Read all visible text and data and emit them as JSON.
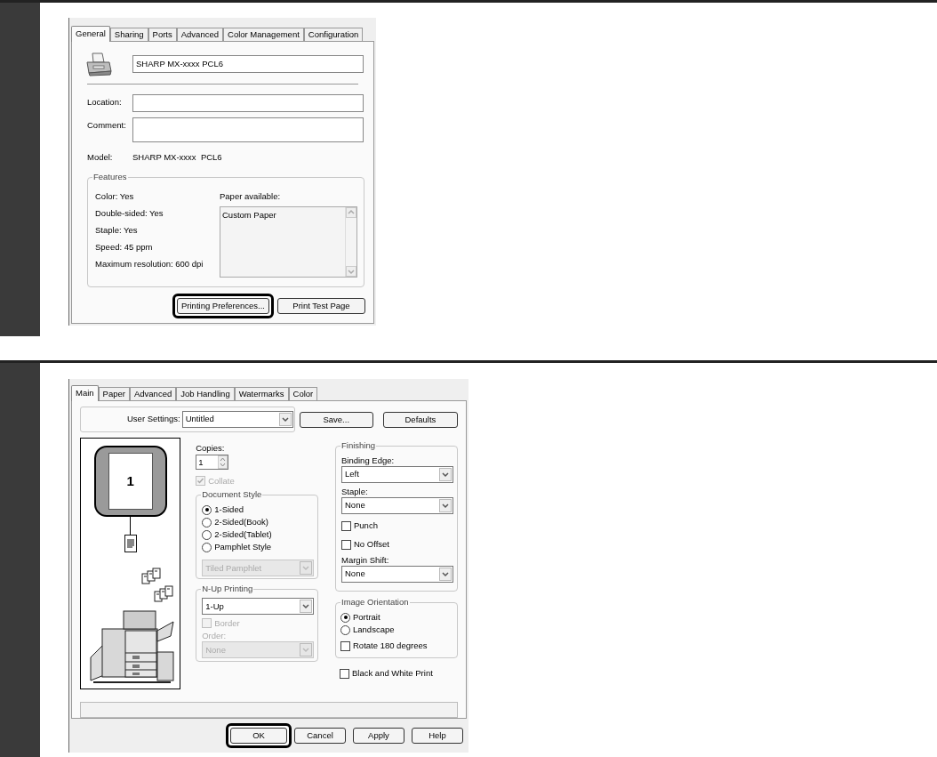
{
  "printer_properties": {
    "tabs": [
      {
        "label": "General",
        "selected": true
      },
      {
        "label": "Sharing",
        "selected": false
      },
      {
        "label": "Ports",
        "selected": false
      },
      {
        "label": "Advanced",
        "selected": false
      },
      {
        "label": "Color Management",
        "selected": false
      },
      {
        "label": "Configuration",
        "selected": false
      }
    ],
    "printer_name": "SHARP MX-xxxx PCL6",
    "fields": [
      {
        "label": "Location:",
        "kind": "line"
      },
      {
        "label": "Comment:",
        "kind": "box"
      }
    ],
    "model": {
      "label": "Model:",
      "value": "SHARP MX-xxxx  PCL6"
    },
    "features": {
      "title": "Features",
      "items": [
        "Color: Yes",
        "Double-sided: Yes",
        "Staple: Yes",
        "Speed: 45 ppm",
        "Maximum resolution: 600 dpi"
      ],
      "paper_label": "Paper available:",
      "paper_list": [
        "Custom Paper"
      ]
    },
    "buttons": [
      {
        "label": "Printing Preferences...",
        "highlighted": true
      },
      {
        "label": "Print Test Page",
        "highlighted": false
      }
    ]
  },
  "printing_preferences": {
    "tabs": [
      {
        "label": "Main",
        "selected": true
      },
      {
        "label": "Paper",
        "selected": false
      },
      {
        "label": "Advanced",
        "selected": false
      },
      {
        "label": "Job Handling",
        "selected": false
      },
      {
        "label": "Watermarks",
        "selected": false
      },
      {
        "label": "Color",
        "selected": false
      }
    ],
    "user_settings": {
      "label": "User Settings:",
      "value": "Untitled"
    },
    "top_buttons": [
      {
        "label": "Save..."
      },
      {
        "label": "Defaults"
      }
    ],
    "preview": {
      "page_number": "1"
    },
    "copies": {
      "label": "Copies:",
      "value": "1"
    },
    "collate": {
      "label": "Collate",
      "checked": true,
      "disabled": true
    },
    "document_style": {
      "title": "Document Style",
      "options": [
        {
          "label": "1-Sided",
          "selected": true
        },
        {
          "label": "2-Sided(Book)",
          "selected": false
        },
        {
          "label": "2-Sided(Tablet)",
          "selected": false
        },
        {
          "label": "Pamphlet Style",
          "selected": false
        }
      ],
      "pamphlet": {
        "value": "Tiled Pamphlet",
        "disabled": true
      }
    },
    "n_up": {
      "title": "N-Up Printing",
      "value": "1-Up",
      "border": {
        "label": "Border",
        "checked": false,
        "disabled": true
      },
      "order_label": "Order:",
      "order": {
        "value": "None",
        "disabled": true
      }
    },
    "finishing": {
      "title": "Finishing",
      "binding_edge_label": "Binding Edge:",
      "binding_edge": "Left",
      "staple_label": "Staple:",
      "staple": "None",
      "checks": [
        {
          "label": "Punch",
          "checked": false
        },
        {
          "label": "No Offset",
          "checked": false
        }
      ],
      "margin_shift_label": "Margin Shift:",
      "margin_shift": "None"
    },
    "image_orientation": {
      "title": "Image Orientation",
      "options": [
        {
          "label": "Portrait",
          "selected": true
        },
        {
          "label": "Landscape",
          "selected": false
        }
      ],
      "rotate": {
        "label": "Rotate 180 degrees",
        "checked": false
      }
    },
    "black_white": {
      "label": "Black and White Print",
      "checked": false
    },
    "buttons": [
      {
        "label": "OK",
        "highlighted": true
      },
      {
        "label": "Cancel",
        "highlighted": false
      },
      {
        "label": "Apply",
        "highlighted": false
      },
      {
        "label": "Help",
        "highlighted": false
      }
    ]
  }
}
